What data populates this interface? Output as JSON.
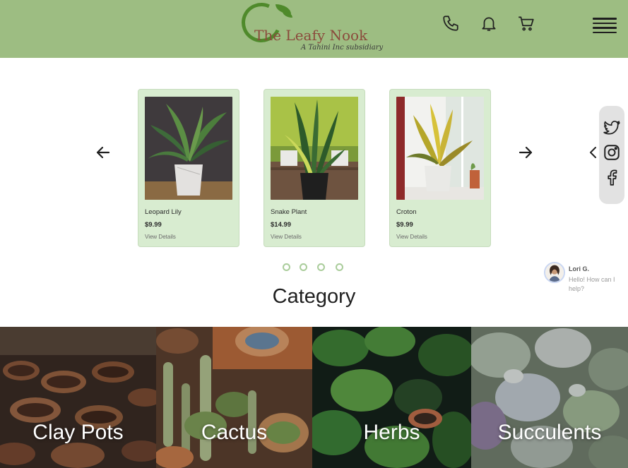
{
  "brand": {
    "name": "The Leafy Nook",
    "tagline": "A Tahini Inc subsidiary"
  },
  "header": {
    "icons": [
      "phone-icon",
      "bell-icon",
      "cart-icon",
      "menu-icon"
    ]
  },
  "products": [
    {
      "name": "Leopard Lily",
      "price": "$9.99",
      "link": "View Details"
    },
    {
      "name": "Snake Plant",
      "price": "$14.99",
      "link": "View Details"
    },
    {
      "name": "Croton",
      "price": "$9.99",
      "link": "View Details"
    }
  ],
  "carousel": {
    "dot_count": 4
  },
  "social": {
    "icons": [
      "twitter-icon",
      "instagram-icon",
      "facebook-icon"
    ]
  },
  "chat": {
    "name": "Lori G.",
    "message": "Hello! How can I help?"
  },
  "category": {
    "heading": "Category",
    "items": [
      {
        "label": "Clay Pots"
      },
      {
        "label": "Cactus"
      },
      {
        "label": "Herbs"
      },
      {
        "label": "Succulents"
      }
    ]
  },
  "colors": {
    "header_bg": "#9dbd82",
    "card_bg": "#d8ecd0",
    "logo_green": "#4f8a2b",
    "logo_text": "#8b4a3c",
    "dot": "#a9cc9a"
  }
}
